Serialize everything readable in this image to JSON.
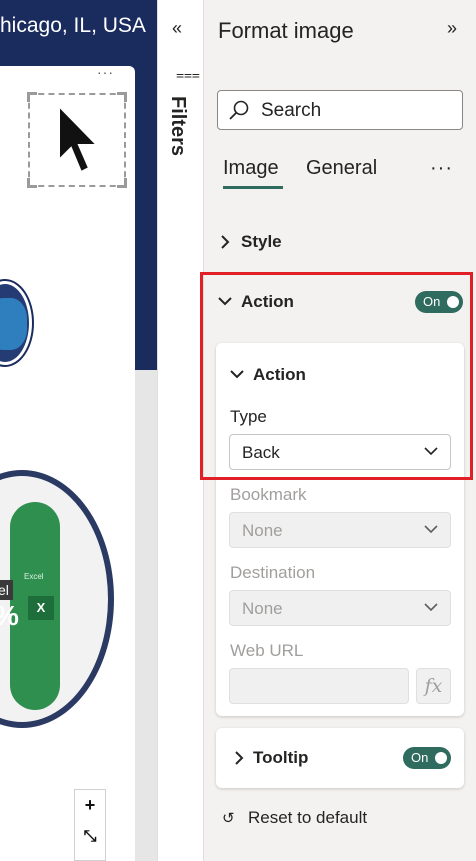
{
  "canvas": {
    "banner_text": "hicago, IL, USA",
    "more_label": "···",
    "badge_small_label": "e",
    "badge_small_pct": "0",
    "badge_big_label": "el",
    "badge_big_pct": "%",
    "board_excel": "Excel",
    "board_x": "X",
    "zoom_in": "+",
    "fit": "⤡"
  },
  "filters": {
    "collapse": "«",
    "icon": "⩶",
    "label": "Filters"
  },
  "pane": {
    "title": "Format image",
    "expand": "»",
    "search_placeholder": "Search",
    "tabs": [
      {
        "label": "Image",
        "active": true
      },
      {
        "label": "General",
        "active": false
      }
    ],
    "more": "···",
    "sections": {
      "style": {
        "label": "Style",
        "expanded": false
      },
      "action": {
        "label": "Action",
        "expanded": true,
        "toggle": "On"
      }
    },
    "action_card": {
      "header": "Action",
      "type_label": "Type",
      "type_value": "Back",
      "bookmark_label": "Bookmark",
      "bookmark_value": "None",
      "destination_label": "Destination",
      "destination_value": "None",
      "web_url_label": "Web URL",
      "fx_label": "fx"
    },
    "tooltip": {
      "label": "Tooltip",
      "toggle": "On"
    },
    "reset": "Reset to default"
  },
  "colors": {
    "accent": "#2f6b5e",
    "highlight": "#e01f27",
    "banner": "#1a2b5e"
  }
}
